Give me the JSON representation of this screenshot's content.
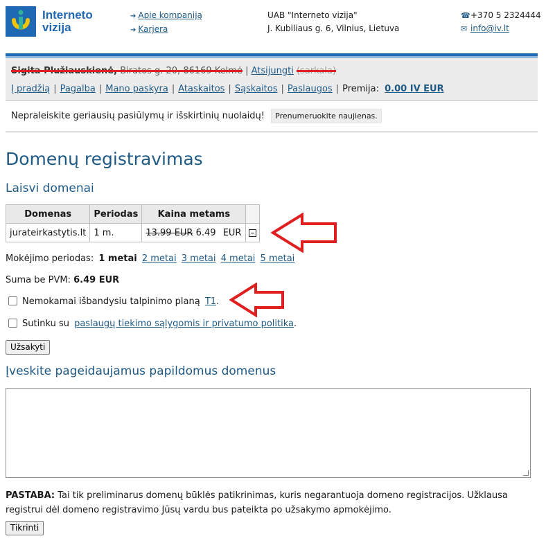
{
  "brand": {
    "name_line1": "Interneto",
    "name_line2": "vizija"
  },
  "header_links": [
    {
      "label": "Apie kompaniją"
    },
    {
      "label": "Karjera"
    }
  ],
  "company": {
    "name": "UAB \"Interneto vizija\"",
    "address": "J. Kubiliaus g. 6, Vilnius, Lietuva"
  },
  "contact": {
    "phone": "+370 5 2324444",
    "email": "info@iv.lt"
  },
  "user": {
    "name": "Sigita Plužiauskienė,",
    "address": " Biratos g. 20, 86169 Kelmė",
    "logout_label": "Atsijungti",
    "extra": "(sarkala)"
  },
  "nav": {
    "items": [
      "Į pradžią",
      "Pagalba",
      "Mano paskyra",
      "Ataskaitos",
      "Sąskaitos",
      "Paslaugos"
    ],
    "premium_label": "Premija:",
    "premium_value": "0.00 IV EUR"
  },
  "promo": {
    "text": "Nepraleiskite geriausių pasiūlymų ir išskirtinių nuolaidų!",
    "button": "Prenumeruokite naujienas."
  },
  "page_title": "Domenų registravimas",
  "free_domains": {
    "heading": "Laisvi domenai",
    "columns": [
      "Domenas",
      "Periodas",
      "Kaina metams"
    ],
    "rows": [
      {
        "domain": "jurateirkastytis.lt",
        "period": "1 m.",
        "old_price": "13.99 EUR",
        "price": "6.49",
        "currency": "EUR"
      }
    ]
  },
  "billing": {
    "label": "Mokėjimo periodas:",
    "selected": "1 metai",
    "options": [
      "2 metai",
      "3 metai",
      "4 metai",
      "5 metai"
    ]
  },
  "total": {
    "label": "Suma be PVM:",
    "value": "6.49 EUR"
  },
  "trial": {
    "text": "Nemokamai išbandysiu talpinimo planą",
    "link": "T1",
    "suffix": ".",
    "checked": false
  },
  "terms": {
    "text": "Sutinku su",
    "link": "paslaugų tiekimo sąlygomis ir privatumo politika",
    "suffix": ".",
    "checked": false
  },
  "order_button": "Užsakyti",
  "more_domains": {
    "heading": "Įveskite pageidaujamus papildomus domenus",
    "value": ""
  },
  "note": {
    "label": "PASTABA:",
    "text": " Tai tik preliminarus domenų būklės patikrinimas, kuris negarantuoja domeno registracijos. Užklausa registrui dėl domeno registravimo Jūsų vardu bus pateikta po užsakymo apmokėjimo."
  },
  "check_button": "Tikrinti",
  "colors": {
    "brand_blue": "#1f68b3",
    "link": "#1f5a85",
    "annotation_red": "#e02020"
  },
  "icons": [
    "logo-mark",
    "arrow-bullet-icon",
    "phone-icon",
    "mail-icon",
    "collapse-minus-icon",
    "annotation-arrow"
  ]
}
